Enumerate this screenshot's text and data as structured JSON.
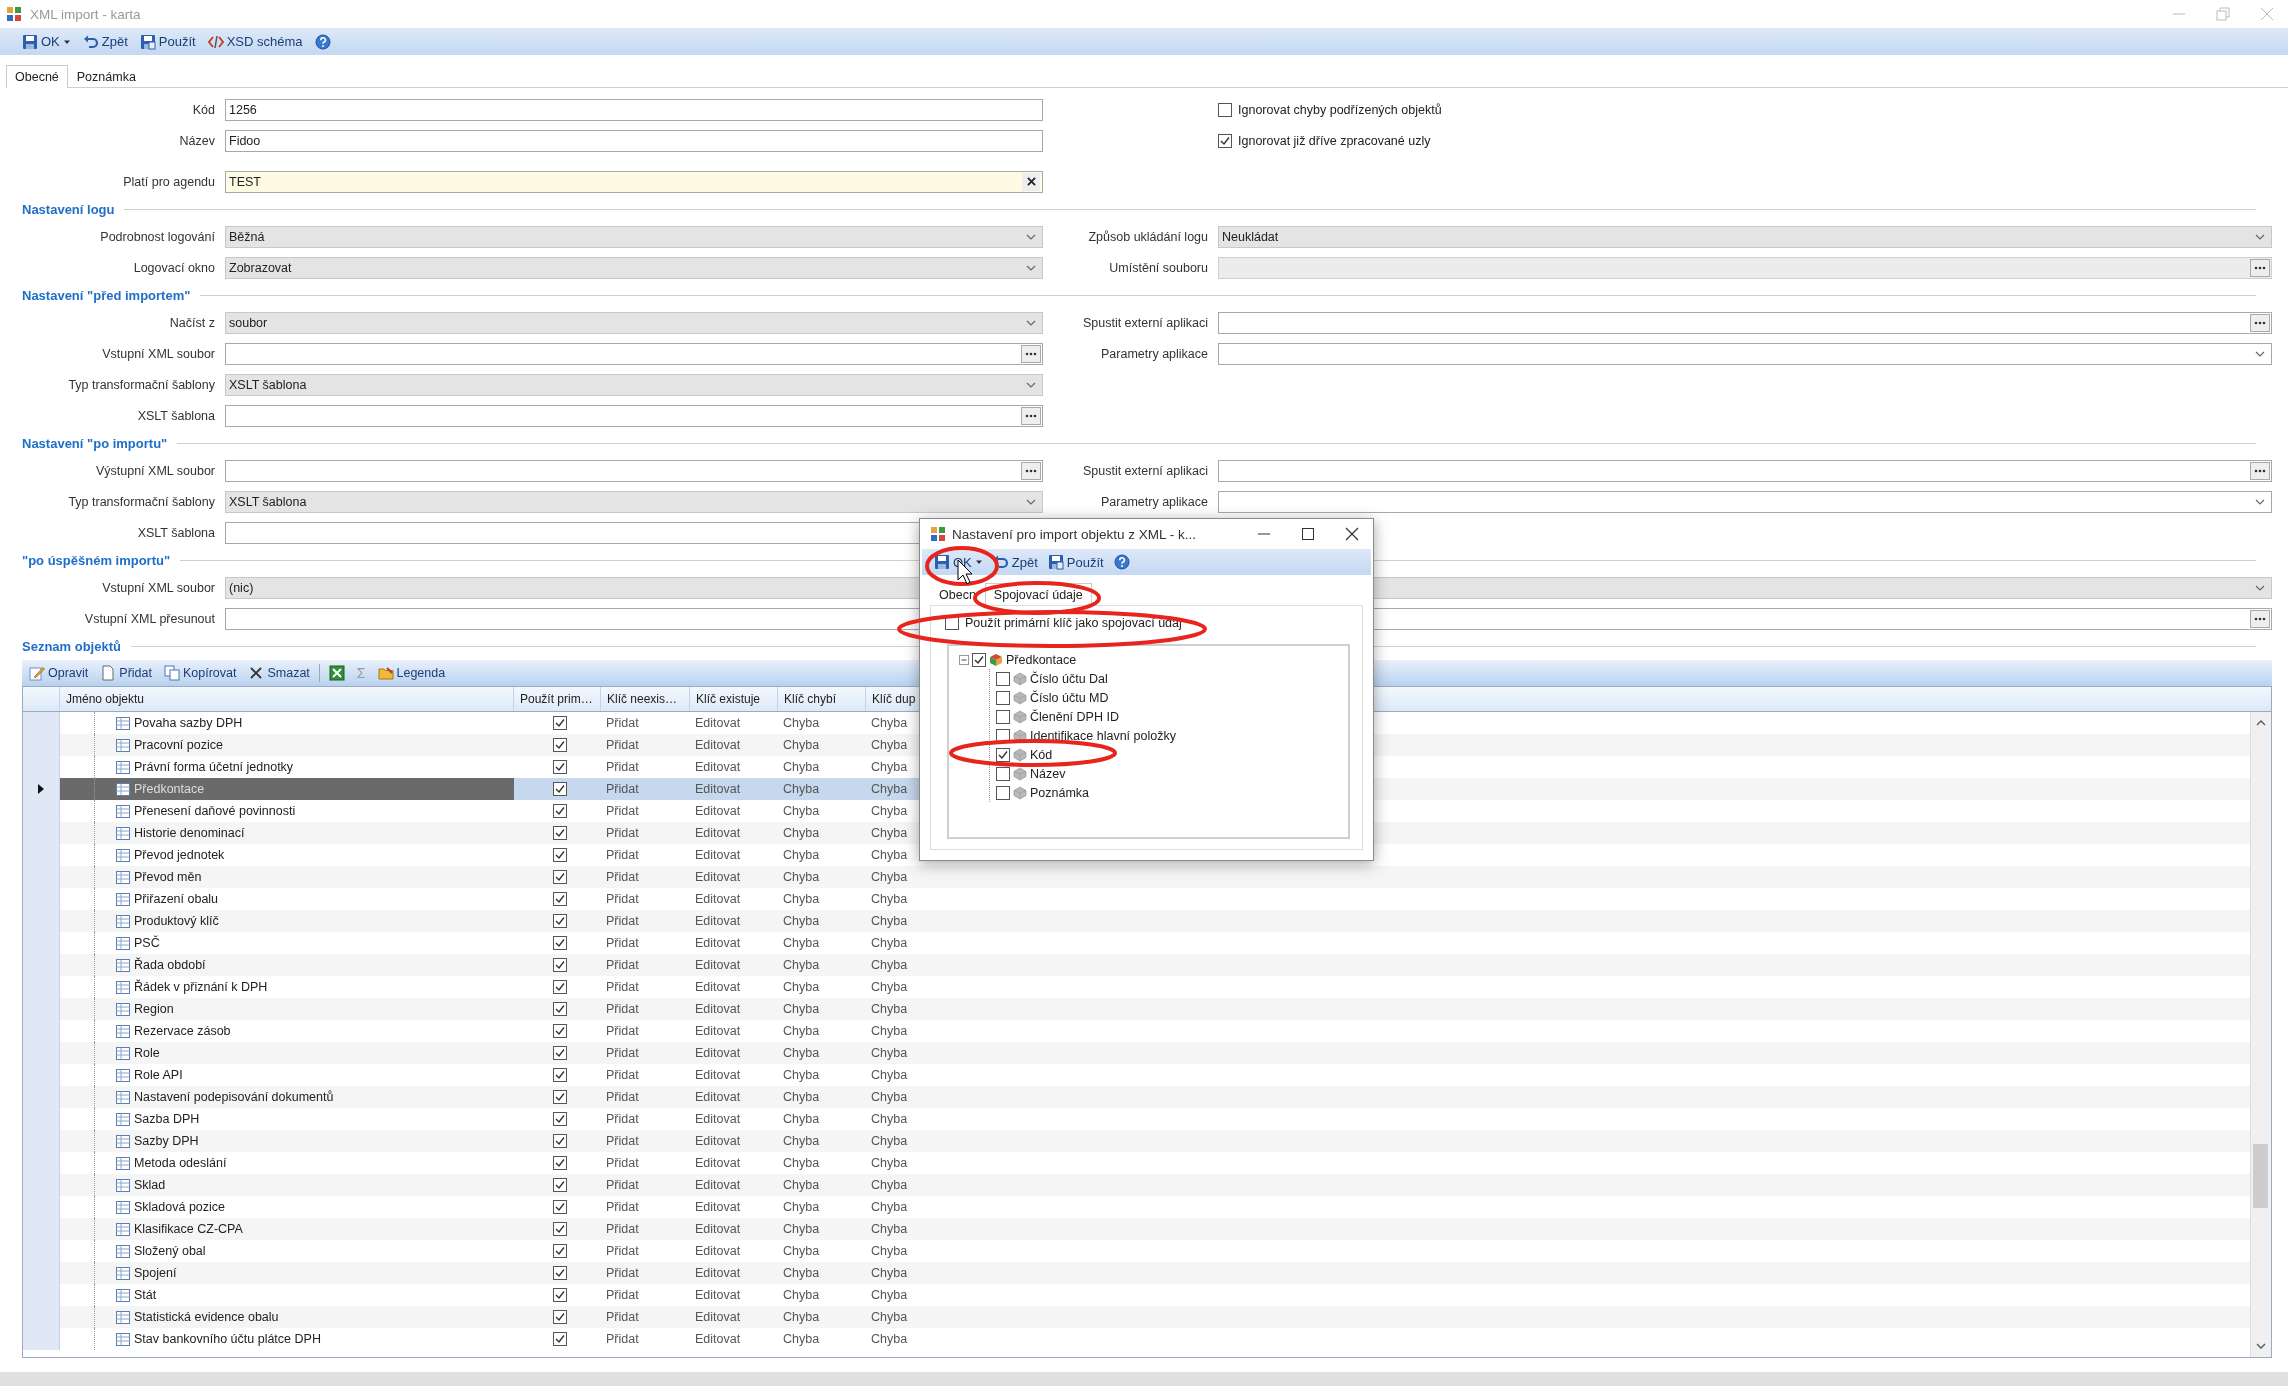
{
  "window": {
    "title": "XML import - karta"
  },
  "toolbar": [
    {
      "kind": "ok",
      "label": "OK",
      "dropdown": true
    },
    {
      "kind": "undo",
      "label": "Zpět",
      "dropdown": false
    },
    {
      "kind": "apply",
      "label": "Použít",
      "dropdown": false
    },
    {
      "kind": "schema",
      "label": "XSD schéma",
      "dropdown": false
    },
    {
      "kind": "help",
      "dropdown": false
    }
  ],
  "tabs": [
    {
      "label": "Obecné",
      "selected": true
    },
    {
      "label": "Poznámka",
      "selected": false
    }
  ],
  "general": [
    {
      "left": {
        "label": "Kód",
        "kind": "text",
        "value": "1256"
      },
      "right": {
        "kind": "check",
        "label": "Ignorovat chyby podřízených objektů",
        "checked": false
      }
    },
    {
      "left": {
        "label": "Název",
        "kind": "text",
        "value": "Fidoo"
      },
      "right": {
        "kind": "check",
        "label": "Ignorovat již dříve zpracované uzly",
        "checked": true
      }
    },
    {
      "left": {
        "label": "Platí pro agendu",
        "kind": "lookup",
        "value": "TEST"
      }
    }
  ],
  "sections": [
    {
      "title": "Nastavení logu",
      "rows": [
        {
          "left": {
            "label": "Podrobnost logování",
            "kind": "combo",
            "value": "Běžná"
          },
          "right": {
            "label": "Způsob ukládání logu",
            "kind": "combo",
            "value": "Neukládat"
          }
        },
        {
          "left": {
            "label": "Logovací okno",
            "kind": "combo",
            "value": "Zobrazovat"
          },
          "right": {
            "label": "Umístění souboru",
            "kind": "locked_browse"
          }
        }
      ]
    },
    {
      "title": "Nastavení \"před importem\"",
      "rows": [
        {
          "left": {
            "label": "Načíst z",
            "kind": "combo",
            "value": "soubor"
          },
          "right": {
            "label": "Spustit externí aplikaci",
            "kind": "browse"
          }
        },
        {
          "left": {
            "label": "Vstupní XML soubor",
            "kind": "browse"
          },
          "right": {
            "label": "Parametry aplikace",
            "kind": "select"
          }
        },
        {
          "left": {
            "label": "Typ transformační šablony",
            "kind": "combo",
            "value": "XSLT šablona"
          }
        },
        {
          "left": {
            "label": "XSLT šablona",
            "kind": "browse"
          }
        }
      ]
    },
    {
      "title": "Nastavení \"po importu\"",
      "rows": [
        {
          "left": {
            "label": "Výstupní XML soubor",
            "kind": "browse"
          },
          "right": {
            "label": "Spustit externí aplikaci",
            "kind": "browse"
          }
        },
        {
          "left": {
            "label": "Typ transformační šablony",
            "kind": "combo",
            "value": "XSLT šablona"
          },
          "right": {
            "label": "Parametry aplikace",
            "kind": "select"
          }
        },
        {
          "left": {
            "label": "XSLT šablona",
            "kind": "text"
          }
        }
      ]
    },
    {
      "title": "\"po úspěšném importu\"",
      "rows": [
        {
          "wide": {
            "label": "Vstupní XML soubor",
            "kind": "combo",
            "value": "(nic)"
          }
        },
        {
          "wide": {
            "label": "Vstupní XML přesunout",
            "kind": "browse"
          }
        }
      ]
    }
  ],
  "objects": {
    "title": "Seznam objektů",
    "toolbar": [
      {
        "kind": "edit",
        "label": "Opravit"
      },
      {
        "kind": "add",
        "label": "Přidat"
      },
      {
        "kind": "copy",
        "label": "Kopírovat"
      },
      {
        "kind": "delete",
        "label": "Smazat"
      },
      {
        "kind": "export"
      },
      {
        "kind": "sum",
        "label": "Σ"
      },
      {
        "kind": "legend",
        "label": "Legenda"
      }
    ],
    "columns": [
      "Jméno objektu",
      "Použít prim…",
      "Klíč neexis…",
      "Klíč existuje",
      "Klíč chybí",
      "Klíč dup"
    ],
    "rows": [
      {
        "name": "Povaha sazby DPH",
        "use_primary": true,
        "not_exists": "Přidat",
        "exists": "Editovat",
        "missing": "Chyba",
        "duplicate": "Chyba",
        "selected": false
      },
      {
        "name": "Pracovní pozice",
        "use_primary": true,
        "not_exists": "Přidat",
        "exists": "Editovat",
        "missing": "Chyba",
        "duplicate": "Chyba",
        "selected": false
      },
      {
        "name": "Právní forma účetní jednotky",
        "use_primary": true,
        "not_exists": "Přidat",
        "exists": "Editovat",
        "missing": "Chyba",
        "duplicate": "Chyba",
        "selected": false
      },
      {
        "name": "Předkontace",
        "use_primary": true,
        "not_exists": "Přidat",
        "exists": "Editovat",
        "missing": "Chyba",
        "duplicate": "Chyba",
        "selected": true
      },
      {
        "name": "Přenesení daňové povinnosti",
        "use_primary": true,
        "not_exists": "Přidat",
        "exists": "Editovat",
        "missing": "Chyba",
        "duplicate": "Chyba",
        "selected": false
      },
      {
        "name": "Historie denominací",
        "use_primary": true,
        "not_exists": "Přidat",
        "exists": "Editovat",
        "missing": "Chyba",
        "duplicate": "Chyba",
        "selected": false
      },
      {
        "name": "Převod jednotek",
        "use_primary": true,
        "not_exists": "Přidat",
        "exists": "Editovat",
        "missing": "Chyba",
        "duplicate": "Chyba",
        "selected": false
      },
      {
        "name": "Převod měn",
        "use_primary": true,
        "not_exists": "Přidat",
        "exists": "Editovat",
        "missing": "Chyba",
        "duplicate": "Chyba",
        "selected": false
      },
      {
        "name": "Přiřazení obalu",
        "use_primary": true,
        "not_exists": "Přidat",
        "exists": "Editovat",
        "missing": "Chyba",
        "duplicate": "Chyba",
        "selected": false
      },
      {
        "name": "Produktový klíč",
        "use_primary": true,
        "not_exists": "Přidat",
        "exists": "Editovat",
        "missing": "Chyba",
        "duplicate": "Chyba",
        "selected": false
      },
      {
        "name": "PSČ",
        "use_primary": true,
        "not_exists": "Přidat",
        "exists": "Editovat",
        "missing": "Chyba",
        "duplicate": "Chyba",
        "selected": false
      },
      {
        "name": "Řada období",
        "use_primary": true,
        "not_exists": "Přidat",
        "exists": "Editovat",
        "missing": "Chyba",
        "duplicate": "Chyba",
        "selected": false
      },
      {
        "name": "Řádek v přiznání k DPH",
        "use_primary": true,
        "not_exists": "Přidat",
        "exists": "Editovat",
        "missing": "Chyba",
        "duplicate": "Chyba",
        "selected": false
      },
      {
        "name": "Region",
        "use_primary": true,
        "not_exists": "Přidat",
        "exists": "Editovat",
        "missing": "Chyba",
        "duplicate": "Chyba",
        "selected": false
      },
      {
        "name": "Rezervace zásob",
        "use_primary": true,
        "not_exists": "Přidat",
        "exists": "Editovat",
        "missing": "Chyba",
        "duplicate": "Chyba",
        "selected": false
      },
      {
        "name": "Role",
        "use_primary": true,
        "not_exists": "Přidat",
        "exists": "Editovat",
        "missing": "Chyba",
        "duplicate": "Chyba",
        "selected": false
      },
      {
        "name": "Role API",
        "use_primary": true,
        "not_exists": "Přidat",
        "exists": "Editovat",
        "missing": "Chyba",
        "duplicate": "Chyba",
        "selected": false
      },
      {
        "name": "Nastavení podepisování dokumentů",
        "use_primary": true,
        "not_exists": "Přidat",
        "exists": "Editovat",
        "missing": "Chyba",
        "duplicate": "Chyba",
        "selected": false
      },
      {
        "name": "Sazba DPH",
        "use_primary": true,
        "not_exists": "Přidat",
        "exists": "Editovat",
        "missing": "Chyba",
        "duplicate": "Chyba",
        "selected": false
      },
      {
        "name": "Sazby DPH",
        "use_primary": true,
        "not_exists": "Přidat",
        "exists": "Editovat",
        "missing": "Chyba",
        "duplicate": "Chyba",
        "selected": false
      },
      {
        "name": "Metoda odeslání",
        "use_primary": true,
        "not_exists": "Přidat",
        "exists": "Editovat",
        "missing": "Chyba",
        "duplicate": "Chyba",
        "selected": false
      },
      {
        "name": "Sklad",
        "use_primary": true,
        "not_exists": "Přidat",
        "exists": "Editovat",
        "missing": "Chyba",
        "duplicate": "Chyba",
        "selected": false
      },
      {
        "name": "Skladová pozice",
        "use_primary": true,
        "not_exists": "Přidat",
        "exists": "Editovat",
        "missing": "Chyba",
        "duplicate": "Chyba",
        "selected": false
      },
      {
        "name": "Klasifikace CZ-CPA",
        "use_primary": true,
        "not_exists": "Přidat",
        "exists": "Editovat",
        "missing": "Chyba",
        "duplicate": "Chyba",
        "selected": false
      },
      {
        "name": "Složený obal",
        "use_primary": true,
        "not_exists": "Přidat",
        "exists": "Editovat",
        "missing": "Chyba",
        "duplicate": "Chyba",
        "selected": false
      },
      {
        "name": "Spojení",
        "use_primary": true,
        "not_exists": "Přidat",
        "exists": "Editovat",
        "missing": "Chyba",
        "duplicate": "Chyba",
        "selected": false
      },
      {
        "name": "Stát",
        "use_primary": true,
        "not_exists": "Přidat",
        "exists": "Editovat",
        "missing": "Chyba",
        "duplicate": "Chyba",
        "selected": false
      },
      {
        "name": "Statistická evidence obalu",
        "use_primary": true,
        "not_exists": "Přidat",
        "exists": "Editovat",
        "missing": "Chyba",
        "duplicate": "Chyba",
        "selected": false
      },
      {
        "name": "Stav bankovního účtu plátce DPH",
        "use_primary": true,
        "not_exists": "Přidat",
        "exists": "Editovat",
        "missing": "Chyba",
        "duplicate": "Chyba",
        "selected": false
      }
    ]
  },
  "dialog": {
    "title": "Nastavení pro import objektu z XML - k...",
    "toolbar": [
      {
        "kind": "ok",
        "label": "OK",
        "dropdown": true
      },
      {
        "kind": "undo",
        "label": "Zpět",
        "dropdown": false
      },
      {
        "kind": "apply",
        "label": "Použít",
        "dropdown": false
      },
      {
        "kind": "help",
        "dropdown": false
      }
    ],
    "tabs": [
      {
        "label": "Obecn",
        "selected": false
      },
      {
        "label": "Spojovací údaje",
        "selected": true
      }
    ],
    "option": {
      "label": "Použít primární klíč jako spojovací údaj",
      "checked": false
    },
    "tree": {
      "label": "Předkontace",
      "checked": true,
      "expanded": true,
      "children": [
        {
          "label": "Číslo účtu Dal",
          "checked": false
        },
        {
          "label": "Číslo účtu MD",
          "checked": false
        },
        {
          "label": "Členění DPH ID",
          "checked": false
        },
        {
          "label": "Identifikace hlavní položky",
          "checked": false
        },
        {
          "label": "Kód",
          "checked": true
        },
        {
          "label": "Název",
          "checked": false
        },
        {
          "label": "Poznámka",
          "checked": false
        }
      ]
    }
  }
}
